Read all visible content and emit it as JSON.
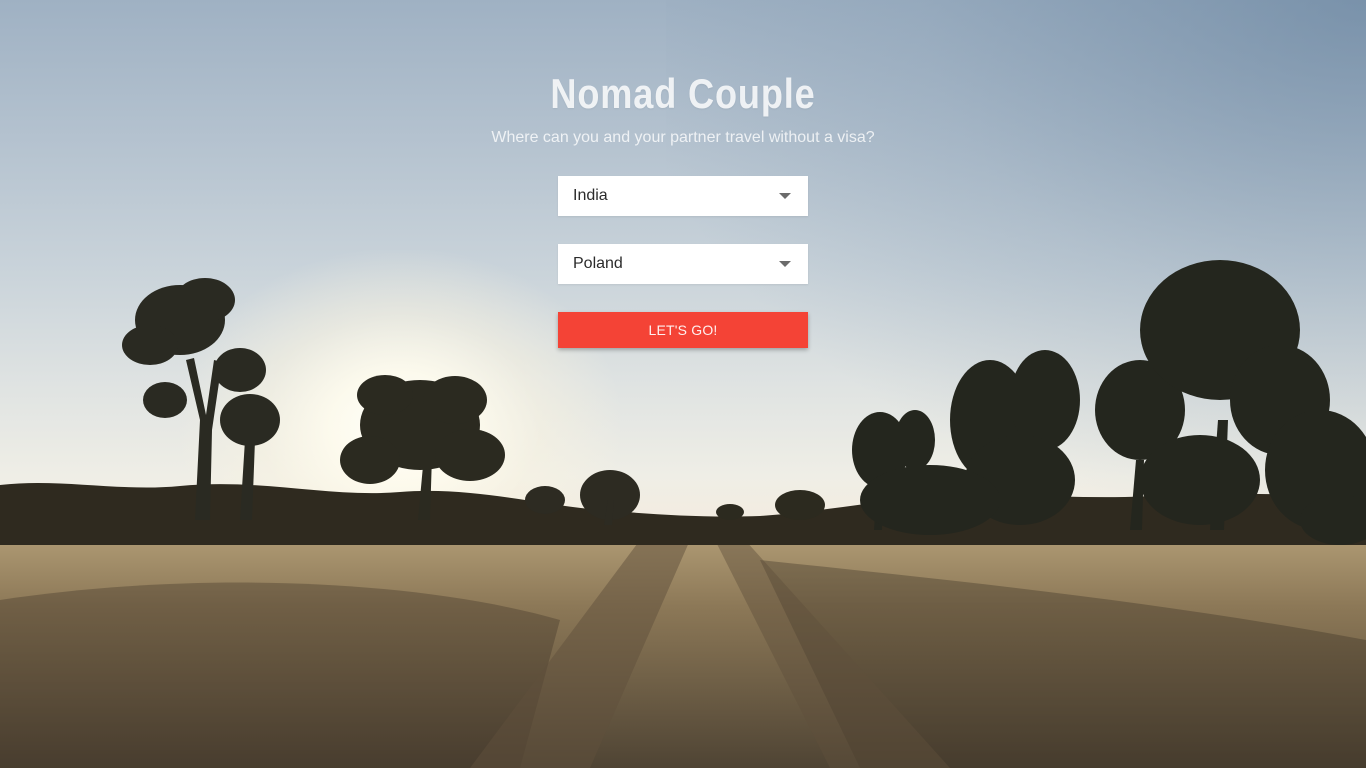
{
  "app": {
    "title": "Nomad Couple",
    "subtitle": "Where can you and your partner travel without a visa?"
  },
  "form": {
    "country_1": {
      "value": "India",
      "icon": "dropdown-caret-icon"
    },
    "country_2": {
      "value": "Poland",
      "icon": "dropdown-caret-icon"
    },
    "submit_label": "LET'S GO!"
  },
  "colors": {
    "accent": "#f44336",
    "input_bg": "#ffffff",
    "title_text": "#ffffff"
  },
  "background": {
    "description_icon": "savanna-sunset-photo"
  }
}
